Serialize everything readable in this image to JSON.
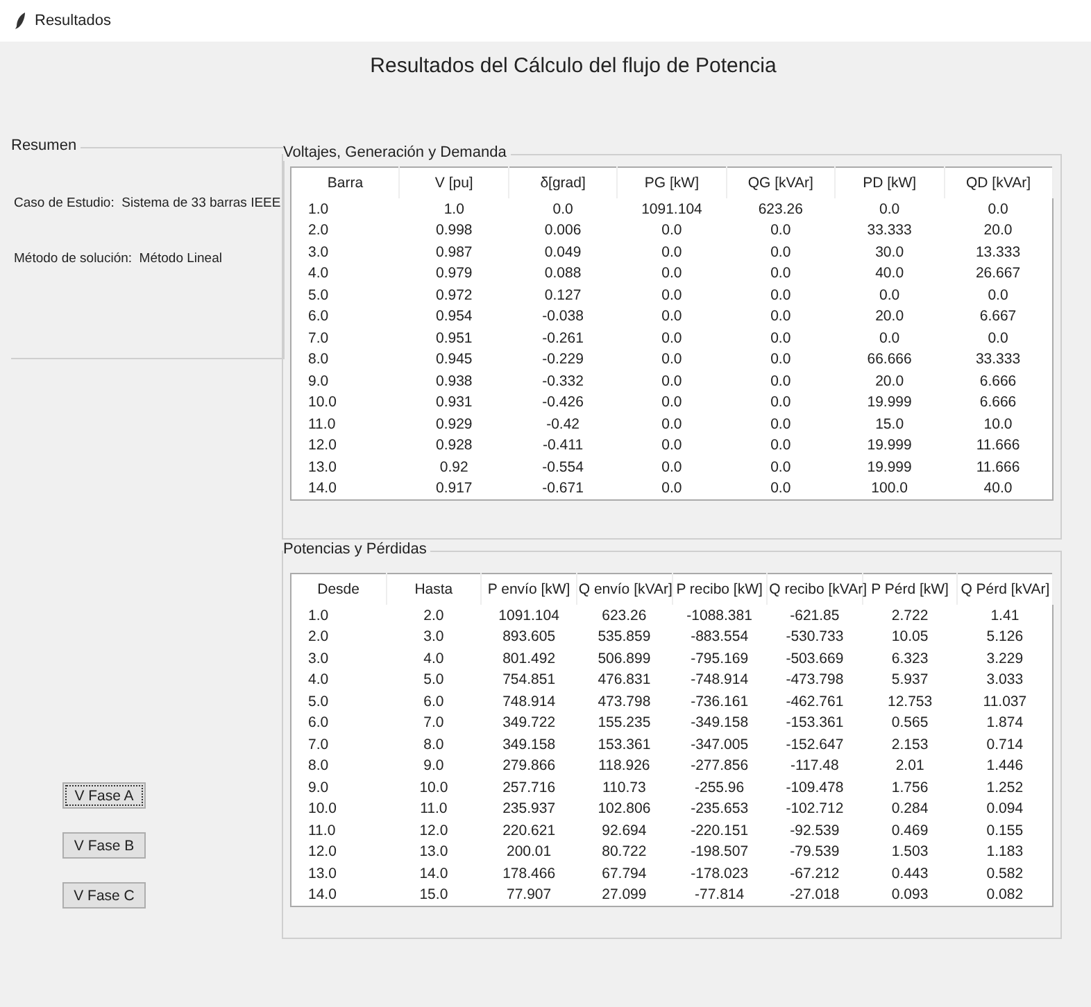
{
  "window": {
    "title": "Resultados"
  },
  "heading": "Resultados del Cálculo del flujo de Potencia",
  "summary": {
    "title": "Resumen",
    "lines": [
      {
        "label": "Caso de Estudio:",
        "value": "Sistema de 33 barras IEEE"
      },
      {
        "label": "Método de solución:",
        "value": "Método Lineal"
      }
    ]
  },
  "buttons": [
    {
      "label": "V Fase A",
      "focused": true
    },
    {
      "label": "V Fase B",
      "focused": false
    },
    {
      "label": "V Fase C",
      "focused": false
    }
  ],
  "tables": [
    {
      "title": "Voltajes, Generación y Demanda",
      "columns": [
        "Barra",
        "V [pu]",
        "δ[grad]",
        "PG [kW]",
        "QG [kVAr]",
        "PD [kW]",
        "QD [kVAr]"
      ],
      "rows": [
        [
          "1.0",
          "1.0",
          "0.0",
          "1091.104",
          "623.26",
          "0.0",
          "0.0"
        ],
        [
          "2.0",
          "0.998",
          "0.006",
          "0.0",
          "0.0",
          "33.333",
          "20.0"
        ],
        [
          "3.0",
          "0.987",
          "0.049",
          "0.0",
          "0.0",
          "30.0",
          "13.333"
        ],
        [
          "4.0",
          "0.979",
          "0.088",
          "0.0",
          "0.0",
          "40.0",
          "26.667"
        ],
        [
          "5.0",
          "0.972",
          "0.127",
          "0.0",
          "0.0",
          "0.0",
          "0.0"
        ],
        [
          "6.0",
          "0.954",
          "-0.038",
          "0.0",
          "0.0",
          "20.0",
          "6.667"
        ],
        [
          "7.0",
          "0.951",
          "-0.261",
          "0.0",
          "0.0",
          "0.0",
          "0.0"
        ],
        [
          "8.0",
          "0.945",
          "-0.229",
          "0.0",
          "0.0",
          "66.666",
          "33.333"
        ],
        [
          "9.0",
          "0.938",
          "-0.332",
          "0.0",
          "0.0",
          "20.0",
          "6.666"
        ],
        [
          "10.0",
          "0.931",
          "-0.426",
          "0.0",
          "0.0",
          "19.999",
          "6.666"
        ],
        [
          "11.0",
          "0.929",
          "-0.42",
          "0.0",
          "0.0",
          "15.0",
          "10.0"
        ],
        [
          "12.0",
          "0.928",
          "-0.411",
          "0.0",
          "0.0",
          "19.999",
          "11.666"
        ],
        [
          "13.0",
          "0.92",
          "-0.554",
          "0.0",
          "0.0",
          "19.999",
          "11.666"
        ],
        [
          "14.0",
          "0.917",
          "-0.671",
          "0.0",
          "0.0",
          "100.0",
          "40.0"
        ]
      ]
    },
    {
      "title": "Potencias y Pérdidas",
      "columns": [
        "Desde",
        "Hasta",
        "P envío [kW]",
        "Q envío [kVAr]",
        "P recibo [kW]",
        "Q recibo [kVAr]",
        "P Pérd [kW]",
        "Q Pérd [kVAr]"
      ],
      "rows": [
        [
          "1.0",
          "2.0",
          "1091.104",
          "623.26",
          "-1088.381",
          "-621.85",
          "2.722",
          "1.41"
        ],
        [
          "2.0",
          "3.0",
          "893.605",
          "535.859",
          "-883.554",
          "-530.733",
          "10.05",
          "5.126"
        ],
        [
          "3.0",
          "4.0",
          "801.492",
          "506.899",
          "-795.169",
          "-503.669",
          "6.323",
          "3.229"
        ],
        [
          "4.0",
          "5.0",
          "754.851",
          "476.831",
          "-748.914",
          "-473.798",
          "5.937",
          "3.033"
        ],
        [
          "5.0",
          "6.0",
          "748.914",
          "473.798",
          "-736.161",
          "-462.761",
          "12.753",
          "11.037"
        ],
        [
          "6.0",
          "7.0",
          "349.722",
          "155.235",
          "-349.158",
          "-153.361",
          "0.565",
          "1.874"
        ],
        [
          "7.0",
          "8.0",
          "349.158",
          "153.361",
          "-347.005",
          "-152.647",
          "2.153",
          "0.714"
        ],
        [
          "8.0",
          "9.0",
          "279.866",
          "118.926",
          "-277.856",
          "-117.48",
          "2.01",
          "1.446"
        ],
        [
          "9.0",
          "10.0",
          "257.716",
          "110.73",
          "-255.96",
          "-109.478",
          "1.756",
          "1.252"
        ],
        [
          "10.0",
          "11.0",
          "235.937",
          "102.806",
          "-235.653",
          "-102.712",
          "0.284",
          "0.094"
        ],
        [
          "11.0",
          "12.0",
          "220.621",
          "92.694",
          "-220.151",
          "-92.539",
          "0.469",
          "0.155"
        ],
        [
          "12.0",
          "13.0",
          "200.01",
          "80.722",
          "-198.507",
          "-79.539",
          "1.503",
          "1.183"
        ],
        [
          "13.0",
          "14.0",
          "178.466",
          "67.794",
          "-178.023",
          "-67.212",
          "0.443",
          "0.582"
        ],
        [
          "14.0",
          "15.0",
          "77.907",
          "27.099",
          "-77.814",
          "-27.018",
          "0.093",
          "0.082"
        ]
      ]
    }
  ]
}
